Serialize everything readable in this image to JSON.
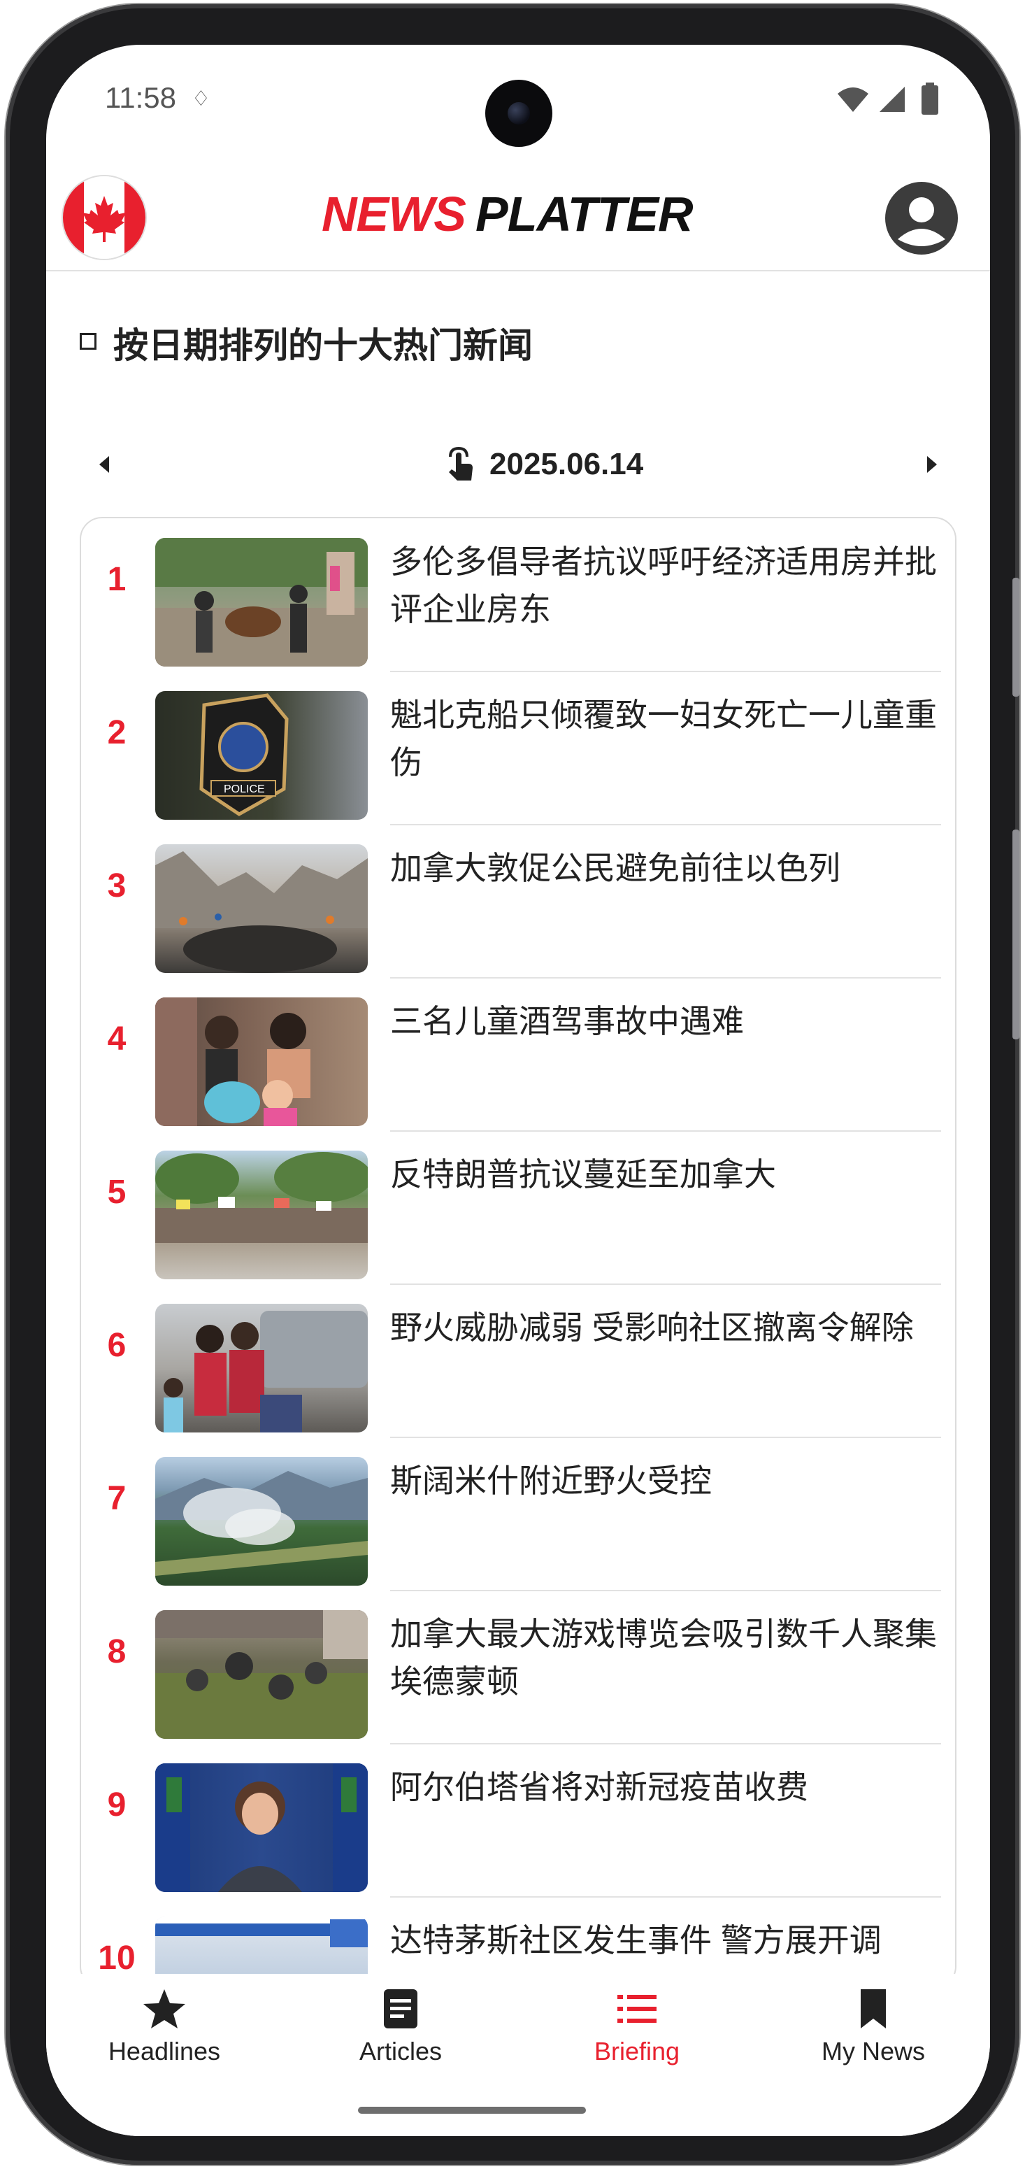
{
  "status_bar": {
    "time": "11:58"
  },
  "header": {
    "logo_part1": "NEWS",
    "logo_part2": "PLATTER",
    "region_flag": "canada-flag-icon",
    "account_icon": "account-circle-icon"
  },
  "section": {
    "title": "按日期排列的十大热门新闻"
  },
  "date_nav": {
    "date": "2025.06.14"
  },
  "list": {
    "items": [
      {
        "rank": "1",
        "title": "多伦多倡导者抗议呼吁经济适用房并批评企业房东"
      },
      {
        "rank": "2",
        "title": "魁北克船只倾覆致一妇女死亡一儿童重伤"
      },
      {
        "rank": "3",
        "title": "加拿大敦促公民避免前往以色列"
      },
      {
        "rank": "4",
        "title": "三名儿童酒驾事故中遇难"
      },
      {
        "rank": "5",
        "title": "反特朗普抗议蔓延至加拿大"
      },
      {
        "rank": "6",
        "title": "野火威胁减弱 受影响社区撤离令解除"
      },
      {
        "rank": "7",
        "title": "斯阔米什附近野火受控"
      },
      {
        "rank": "8",
        "title": "加拿大最大游戏博览会吸引数千人聚集埃德蒙顿"
      },
      {
        "rank": "9",
        "title": "阿尔伯塔省将对新冠疫苗收费"
      },
      {
        "rank": "10",
        "title": "达特茅斯社区发生事件 警方展开调"
      }
    ]
  },
  "bottom_nav": {
    "items": [
      {
        "label": "Headlines",
        "icon": "star-icon"
      },
      {
        "label": "Articles",
        "icon": "article-icon"
      },
      {
        "label": "Briefing",
        "icon": "list-icon",
        "active": true
      },
      {
        "label": "My News",
        "icon": "bookmark-icon"
      }
    ]
  },
  "colors": {
    "accent": "#e8202e",
    "text": "#222222",
    "divider": "#e2e2e2"
  }
}
